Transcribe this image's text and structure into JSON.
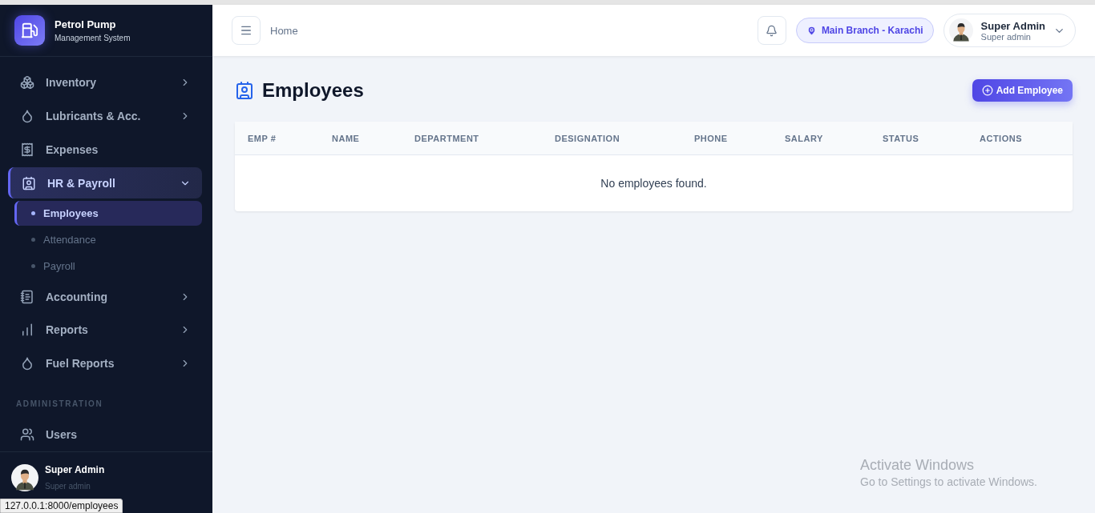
{
  "sidebar": {
    "brand": {
      "title": "Petrol Pump",
      "subtitle": "Management System"
    },
    "nav": [
      {
        "kind": "menu",
        "label": "Inventory",
        "expanded": false
      },
      {
        "kind": "menu",
        "label": "Lubricants & Acc.",
        "expanded": false
      },
      {
        "kind": "link",
        "label": "Expenses"
      },
      {
        "kind": "menu",
        "label": "HR & Payroll",
        "expanded": true,
        "children": [
          {
            "label": "Employees",
            "selected": true
          },
          {
            "label": "Attendance",
            "selected": false
          },
          {
            "label": "Payroll",
            "selected": false
          }
        ]
      },
      {
        "kind": "menu",
        "label": "Accounting",
        "expanded": false
      },
      {
        "kind": "menu",
        "label": "Reports",
        "expanded": false
      },
      {
        "kind": "menu",
        "label": "Fuel Reports",
        "expanded": false
      },
      {
        "kind": "heading",
        "label": "ADMINISTRATION"
      },
      {
        "kind": "link",
        "label": "Users"
      }
    ],
    "user": {
      "name": "Super Admin",
      "role": "Super admin"
    }
  },
  "topbar": {
    "breadcrumb": "Home",
    "branch": "Main Branch - Karachi",
    "user": {
      "name": "Super Admin",
      "role": "Super admin"
    }
  },
  "page": {
    "title": "Employees",
    "add_button": "Add Employee",
    "table": {
      "columns": [
        "EMP #",
        "NAME",
        "DEPARTMENT",
        "DESIGNATION",
        "PHONE",
        "SALARY",
        "STATUS",
        "ACTIONS"
      ],
      "empty_message": "No employees found."
    }
  },
  "status_url": "127.0.0.1:8000/employees",
  "os_notice": {
    "title": "Activate Windows",
    "text": "Go to Settings to activate Windows."
  }
}
